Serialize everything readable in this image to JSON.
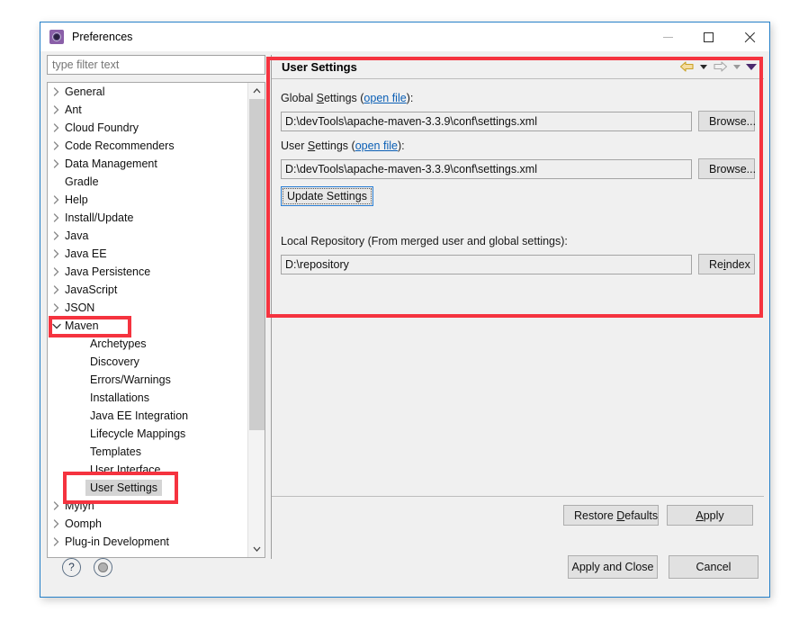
{
  "window": {
    "title": "Preferences",
    "icon": "preferences-gear-icon",
    "minimize_label": "Minimize",
    "maximize_label": "Maximize",
    "close_label": "Close",
    "border_color": "#2680c8"
  },
  "filter": {
    "placeholder": "type filter text",
    "value": ""
  },
  "tree": {
    "items": [
      {
        "label": "General",
        "depth": 1,
        "expandable": true,
        "expanded": false,
        "selected": false
      },
      {
        "label": "Ant",
        "depth": 1,
        "expandable": true,
        "expanded": false,
        "selected": false
      },
      {
        "label": "Cloud Foundry",
        "depth": 1,
        "expandable": true,
        "expanded": false,
        "selected": false
      },
      {
        "label": "Code Recommenders",
        "depth": 1,
        "expandable": true,
        "expanded": false,
        "selected": false
      },
      {
        "label": "Data Management",
        "depth": 1,
        "expandable": true,
        "expanded": false,
        "selected": false
      },
      {
        "label": "Gradle",
        "depth": 1,
        "expandable": false,
        "expanded": false,
        "selected": false
      },
      {
        "label": "Help",
        "depth": 1,
        "expandable": true,
        "expanded": false,
        "selected": false
      },
      {
        "label": "Install/Update",
        "depth": 1,
        "expandable": true,
        "expanded": false,
        "selected": false
      },
      {
        "label": "Java",
        "depth": 1,
        "expandable": true,
        "expanded": false,
        "selected": false
      },
      {
        "label": "Java EE",
        "depth": 1,
        "expandable": true,
        "expanded": false,
        "selected": false
      },
      {
        "label": "Java Persistence",
        "depth": 1,
        "expandable": true,
        "expanded": false,
        "selected": false
      },
      {
        "label": "JavaScript",
        "depth": 1,
        "expandable": true,
        "expanded": false,
        "selected": false
      },
      {
        "label": "JSON",
        "depth": 1,
        "expandable": true,
        "expanded": false,
        "selected": false
      },
      {
        "label": "Maven",
        "depth": 1,
        "expandable": true,
        "expanded": true,
        "selected": false
      },
      {
        "label": "Archetypes",
        "depth": 2,
        "expandable": false,
        "expanded": false,
        "selected": false
      },
      {
        "label": "Discovery",
        "depth": 2,
        "expandable": false,
        "expanded": false,
        "selected": false
      },
      {
        "label": "Errors/Warnings",
        "depth": 2,
        "expandable": false,
        "expanded": false,
        "selected": false
      },
      {
        "label": "Installations",
        "depth": 2,
        "expandable": false,
        "expanded": false,
        "selected": false
      },
      {
        "label": "Java EE Integration",
        "depth": 2,
        "expandable": false,
        "expanded": false,
        "selected": false
      },
      {
        "label": "Lifecycle Mappings",
        "depth": 2,
        "expandable": false,
        "expanded": false,
        "selected": false
      },
      {
        "label": "Templates",
        "depth": 2,
        "expandable": false,
        "expanded": false,
        "selected": false
      },
      {
        "label": "User Interface",
        "depth": 2,
        "expandable": false,
        "expanded": false,
        "selected": false
      },
      {
        "label": "User Settings",
        "depth": 2,
        "expandable": false,
        "expanded": false,
        "selected": true
      },
      {
        "label": "Mylyn",
        "depth": 1,
        "expandable": true,
        "expanded": false,
        "selected": false
      },
      {
        "label": "Oomph",
        "depth": 1,
        "expandable": true,
        "expanded": false,
        "selected": false
      },
      {
        "label": "Plug-in Development",
        "depth": 1,
        "expandable": true,
        "expanded": false,
        "selected": false
      }
    ],
    "scroll_up_icon": "chevron-up-icon",
    "scroll_down_icon": "chevron-down-icon"
  },
  "panel": {
    "title": "User Settings",
    "nav": {
      "back_icon": "back-arrow-icon",
      "back_menu_icon": "caret-down-icon",
      "forward_icon": "forward-arrow-icon",
      "forward_menu_icon": "caret-down-icon",
      "more_icon": "caret-down-purple-icon"
    },
    "global_settings": {
      "label_prefix": "Global ",
      "label_mnemonic": "S",
      "label_rest": "ettings (",
      "link": "open file",
      "label_suffix": "):",
      "value": "D:\\devTools\\apache-maven-3.3.9\\conf\\settings.xml",
      "browse_label": "Browse..."
    },
    "user_settings": {
      "label_prefix": "User ",
      "label_mnemonic": "S",
      "label_rest": "ettings (",
      "link": "open file",
      "label_suffix": "):",
      "value": "D:\\devTools\\apache-maven-3.3.9\\conf\\settings.xml",
      "browse_label": "Browse..."
    },
    "update_settings_label": "Update Settings",
    "local_repository": {
      "label": "Local Repository (From merged user and global settings):",
      "value": "D:\\repository",
      "reindex_prefix": "Re",
      "reindex_mnemonic": "i",
      "reindex_rest": "ndex"
    },
    "restore_defaults": {
      "prefix": "Restore ",
      "mnemonic": "D",
      "rest": "efaults"
    },
    "apply": {
      "prefix": "",
      "mnemonic": "A",
      "rest": "pply"
    }
  },
  "footer": {
    "help_icon": "help-question-icon",
    "secondary_icon": "circle-button-icon",
    "apply_and_close_label": "Apply and Close",
    "cancel_label": "Cancel"
  },
  "annotations": {
    "color": "#f5333f",
    "boxes": [
      {
        "name": "panel-highlight",
        "target": "User Settings panel"
      },
      {
        "name": "maven-highlight",
        "target": "Maven"
      },
      {
        "name": "user-settings-highlight",
        "target": "User Settings"
      }
    ]
  }
}
